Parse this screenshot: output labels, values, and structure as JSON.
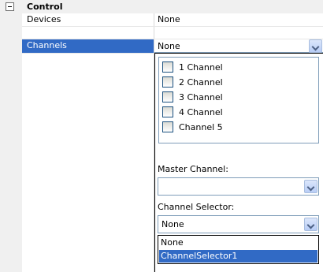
{
  "category": {
    "label": "Control"
  },
  "properties": [
    {
      "name": "Devices",
      "value": "None"
    },
    {
      "name": "Channels",
      "value": "None"
    }
  ],
  "editor": {
    "channels": [
      {
        "label": "1 Channel",
        "checked": false
      },
      {
        "label": "2 Channel",
        "checked": false
      },
      {
        "label": "3 Channel",
        "checked": false
      },
      {
        "label": "4 Channel",
        "checked": false
      },
      {
        "label": "Channel 5",
        "checked": false
      }
    ],
    "master_label": "Master Channel:",
    "master_value": "",
    "selector_label": "Channel Selector:",
    "selector_value": "None",
    "selector_options": [
      "None",
      "ChannelSelector1"
    ],
    "selector_highlighted": "ChannelSelector1"
  },
  "colors": {
    "selection": "#316ac5",
    "gutter": "#f0f0f0"
  },
  "icons": [
    "collapse-minus-icon",
    "chevron-down-icon"
  ]
}
